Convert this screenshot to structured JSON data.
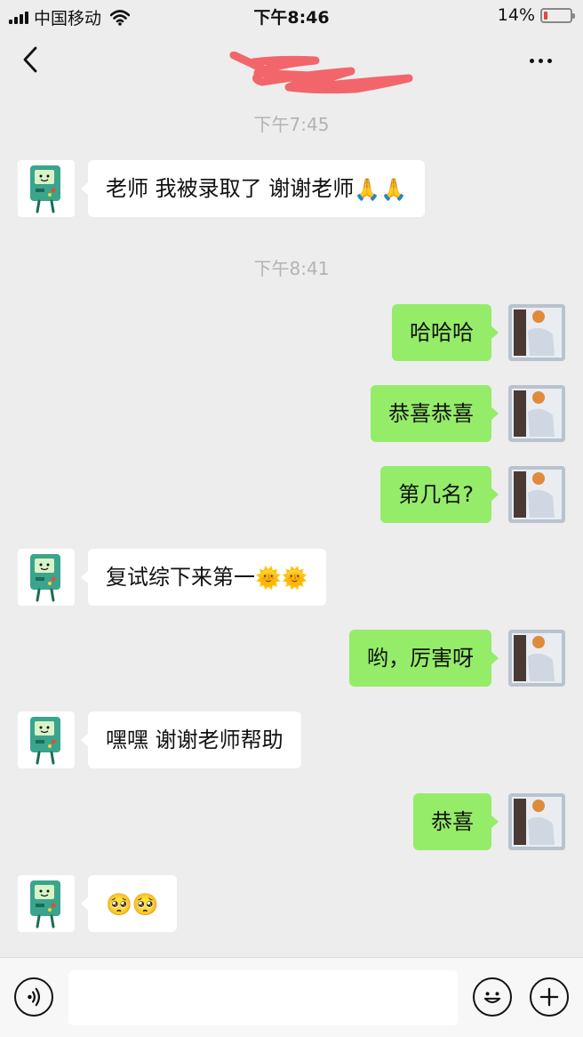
{
  "status_bar": {
    "carrier": "中国移动",
    "time": "下午8:46",
    "battery_text": "14%",
    "battery_level": 0.14,
    "battery_color": "#e8443a"
  },
  "nav": {
    "back_icon": "chevron-left-icon",
    "more_icon": "more-dots-icon",
    "title_obscured_color": "#f25a5f"
  },
  "chat": {
    "timestamps": [
      "下午7:45",
      "下午8:41"
    ],
    "messages": [
      {
        "side": "left",
        "text": "老师 我被录取了 谢谢老师",
        "emoji": "🙏🙏"
      },
      {
        "side": "right",
        "text": "哈哈哈"
      },
      {
        "side": "right",
        "text": "恭喜恭喜"
      },
      {
        "side": "right",
        "text": "第几名?"
      },
      {
        "side": "left",
        "text": "复试综下来第一",
        "emoji": "🌞🌞"
      },
      {
        "side": "right",
        "text": "哟，厉害呀"
      },
      {
        "side": "left",
        "text": "嘿嘿 谢谢老师帮助"
      },
      {
        "side": "right",
        "text": "恭喜"
      },
      {
        "side": "left",
        "text": "",
        "emoji": "🥺🥺"
      }
    ]
  },
  "input_bar": {
    "voice_icon": "voice-icon",
    "emoji_icon": "emoji-icon",
    "plus_icon": "plus-icon",
    "input_value": ""
  },
  "colors": {
    "background": "#ededed",
    "sent_bubble": "#95ec69",
    "received_bubble": "#ffffff",
    "timestamp_text": "#b3b3b3"
  }
}
